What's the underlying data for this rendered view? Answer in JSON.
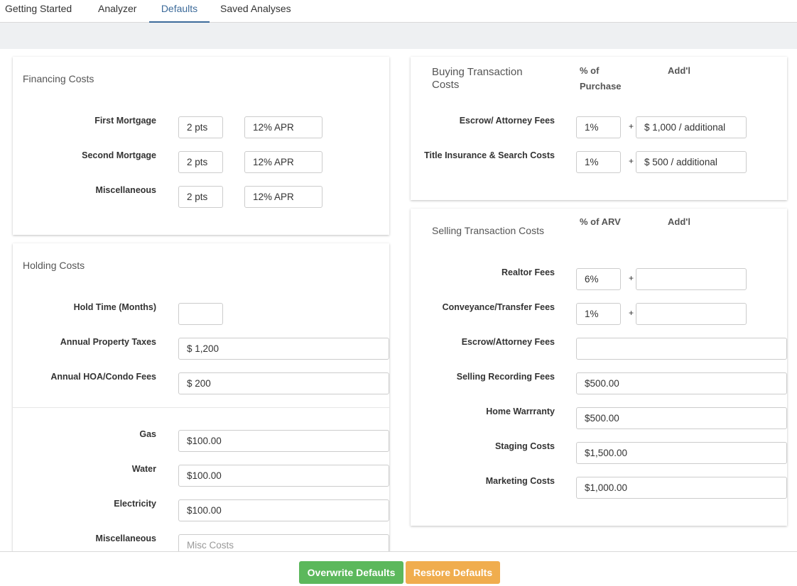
{
  "tabs": [
    "Getting Started",
    "Analyzer",
    "Defaults",
    "Saved Analyses"
  ],
  "colors": {
    "accent": "#3d6b9a",
    "overwrite": "#5cb85c",
    "restore": "#f0ad4e"
  },
  "financing": {
    "title": "Financing Costs",
    "rows": [
      {
        "label": "First Mortgage",
        "points": "2 pts",
        "apr": "12% APR"
      },
      {
        "label": "Second Mortgage",
        "points": "2 pts",
        "apr": "12% APR"
      },
      {
        "label": "Miscellaneous",
        "points": "2 pts",
        "apr": "12% APR"
      }
    ]
  },
  "holding": {
    "title": "Holding Costs",
    "rows": [
      {
        "label": "Hold Time (Months)",
        "value": ""
      },
      {
        "label": "Annual Property Taxes",
        "value": "$ 1,200"
      },
      {
        "label": "Annual HOA/Condo Fees",
        "value": "$ 200"
      }
    ],
    "utilities": [
      {
        "label": "Gas",
        "value": "$100.00"
      },
      {
        "label": "Water",
        "value": "$100.00"
      },
      {
        "label": "Electricity",
        "value": "$100.00"
      },
      {
        "label": "Miscellaneous",
        "value": "",
        "placeholder": "Misc Costs"
      }
    ]
  },
  "buying": {
    "title": "Buying Transaction Costs",
    "col_pct": "% of Purchase",
    "col_addl": "Add'l",
    "rows": [
      {
        "label": "Escrow/ Attorney Fees",
        "pct": "1%",
        "addl": "$ 1,000 / additional"
      },
      {
        "label": "Title Insurance & Search Costs",
        "pct": "1%",
        "addl": "$ 500 / additional"
      }
    ]
  },
  "selling": {
    "title": "Selling Transaction Costs",
    "col_pct": "% of ARV",
    "col_addl": "Add'l",
    "rows": [
      {
        "label": "Realtor Fees",
        "pct": "6%",
        "addl": ""
      },
      {
        "label": "Conveyance/Transfer Fees",
        "pct": "1%",
        "addl": ""
      }
    ],
    "fields": [
      {
        "label": "Escrow/Attorney Fees",
        "value": ""
      },
      {
        "label": "Selling Recording Fees",
        "value": "$500.00"
      },
      {
        "label": "Home Warrranty",
        "value": "$500.00"
      },
      {
        "label": "Staging Costs",
        "value": "$1,500.00"
      },
      {
        "label": "Marketing Costs",
        "value": "$1,000.00"
      }
    ]
  },
  "buttons": {
    "overwrite": "Overwrite Defaults",
    "restore": "Restore Defaults"
  },
  "plus_sign": "+"
}
